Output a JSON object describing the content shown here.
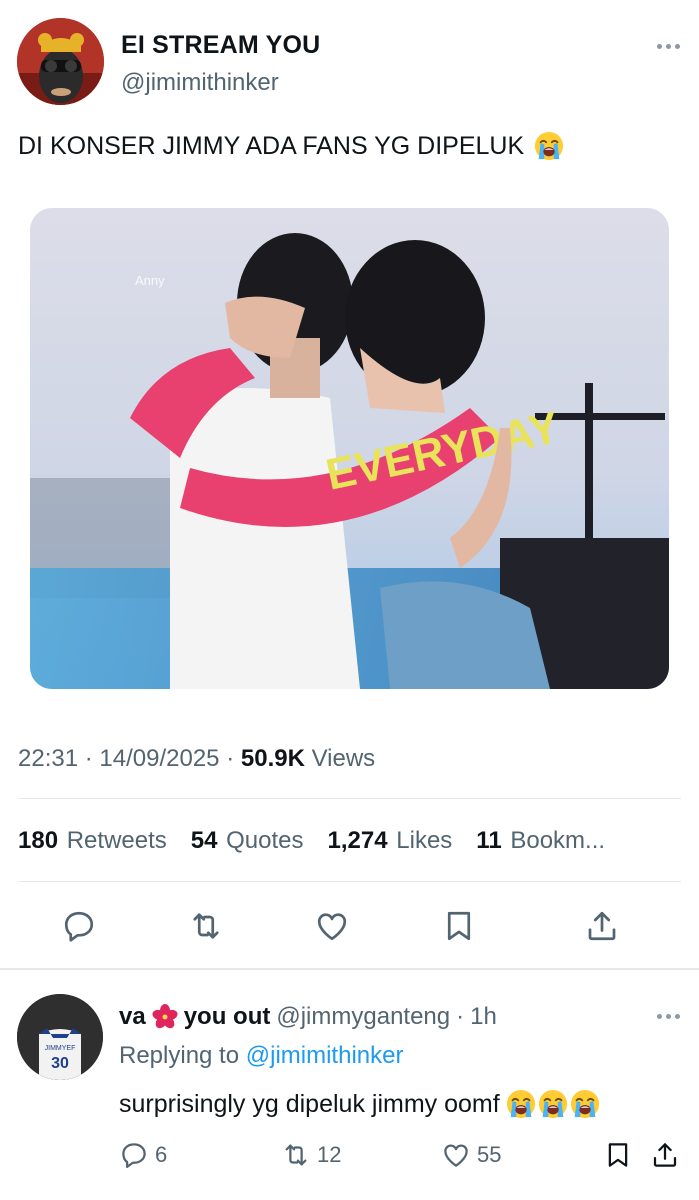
{
  "tweet": {
    "display_name": "EI STREAM YOU",
    "handle": "@jimimithinker",
    "text": "DI KONSER JIMMY ADA FANS YG DIPELUK",
    "photo_watermark": "Anny",
    "photo_shirt_text": "EVERYDAY",
    "time": "22:31",
    "date": "14/09/2025",
    "views_count": "50.9K",
    "views_label": "Views",
    "stats": {
      "retweets_count": "180",
      "retweets_label": "Retweets",
      "quotes_count": "54",
      "quotes_label": "Quotes",
      "likes_count": "1,274",
      "likes_label": "Likes",
      "bookmarks_count": "11",
      "bookmarks_label": "Bookm..."
    }
  },
  "reply": {
    "name_part1": "va",
    "name_part2": "you out",
    "handle": "@jimmyganteng",
    "time": "1h",
    "replying_prefix": "Replying to",
    "replying_to": "@jimimithinker",
    "text": "surprisingly yg dipeluk jimmy oomf",
    "avatar_jersey_number": "30",
    "avatar_jersey_name": "JIMMYEF",
    "reply_count": "6",
    "retweet_count": "12",
    "like_count": "55"
  },
  "icons": [
    "more-icon",
    "reply-icon",
    "retweet-icon",
    "like-icon",
    "bookmark-icon",
    "share-icon",
    "hibiscus-icon",
    "crying-face-icon"
  ],
  "colors": {
    "text_primary": "#0f1419",
    "text_secondary": "#536471",
    "link": "#1d9bf0",
    "divider": "#e6e9ec"
  }
}
